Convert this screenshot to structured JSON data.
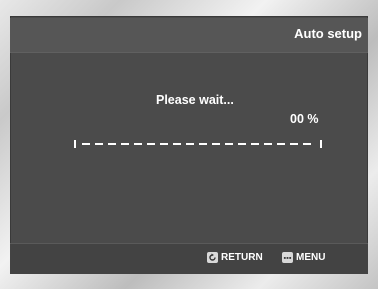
{
  "header": {
    "title": "Auto setup"
  },
  "status": {
    "message": "Please wait...",
    "percent_text": "00 %"
  },
  "progress": {
    "fraction": 0.0
  },
  "footer": {
    "return_label": "RETURN",
    "menu_label": "MENU",
    "return_icon": "return-icon",
    "menu_icon": "menu-icon"
  },
  "colors": {
    "panel": "#4b4b4b",
    "text": "#ffffff"
  }
}
